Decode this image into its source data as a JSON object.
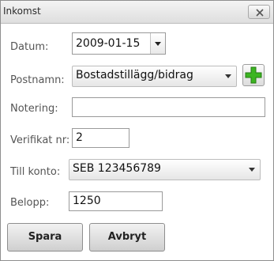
{
  "window": {
    "title": "Inkomst"
  },
  "form": {
    "datum_label": "Datum:",
    "datum_value": "2009-01-15",
    "postnamn_label": "Postnamn:",
    "postnamn_value": "Bostadstillägg/bidrag",
    "notering_label": "Notering:",
    "notering_value": "",
    "verifikat_label": "Verifikat nr:",
    "verifikat_value": "2",
    "tillkonto_label": "Till konto:",
    "tillkonto_value": "SEB 123456789",
    "belopp_label": "Belopp:",
    "belopp_value": "1250"
  },
  "buttons": {
    "save_label": "Spara",
    "cancel_label": "Avbryt"
  },
  "icons": {
    "close": "close-icon",
    "add": "plus-icon",
    "dropdown": "chevron-down-icon"
  },
  "colors": {
    "add_icon_green": "#3cb521"
  }
}
